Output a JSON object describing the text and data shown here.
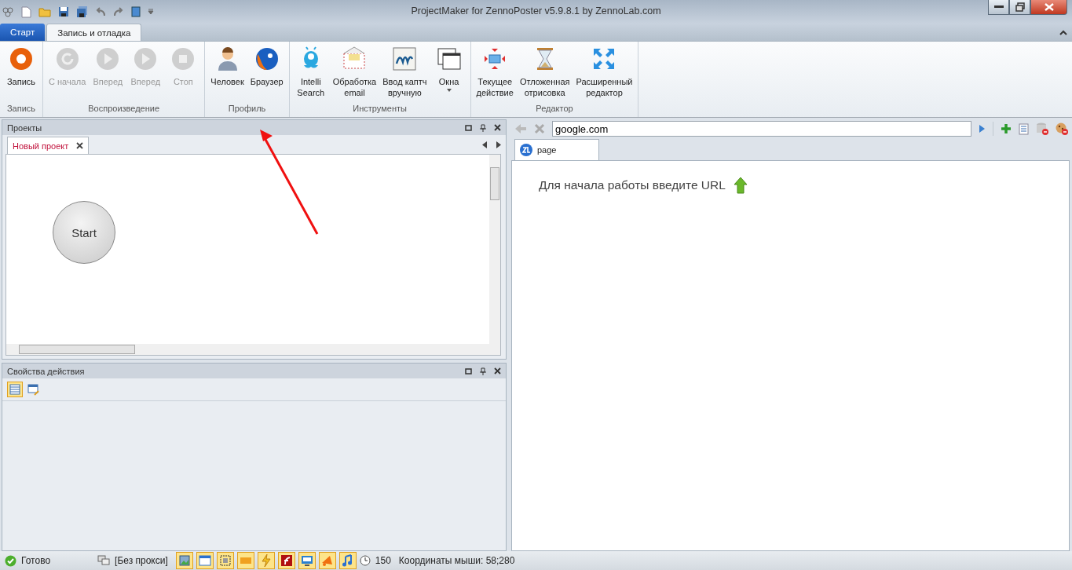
{
  "window": {
    "title": "ProjectMaker for ZennoPoster v5.9.8.1 by ZennoLab.com"
  },
  "ribbon": {
    "tabs": [
      {
        "label": "Старт",
        "selected": false
      },
      {
        "label": "Запись и отладка",
        "selected": true
      }
    ],
    "groups": [
      {
        "label": "Запись",
        "buttons": [
          {
            "label": "Запись",
            "disabled": false
          }
        ]
      },
      {
        "label": "Воспроизведение",
        "buttons": [
          {
            "label": "С начала",
            "disabled": true
          },
          {
            "label": "Вперед",
            "disabled": true
          },
          {
            "label": "Вперед",
            "disabled": true
          },
          {
            "label": "Стоп",
            "disabled": true
          }
        ]
      },
      {
        "label": "Профиль",
        "buttons": [
          {
            "label": "Человек",
            "disabled": false
          },
          {
            "label": "Браузер",
            "disabled": false
          }
        ]
      },
      {
        "label": "Инструменты",
        "buttons": [
          {
            "label": "Intelli\nSearch",
            "disabled": false
          },
          {
            "label": "Обработка\nemail",
            "disabled": false
          },
          {
            "label": "Ввод каптч\nвручную",
            "disabled": false
          },
          {
            "label": "Окна",
            "disabled": false
          }
        ]
      },
      {
        "label": "Редактор",
        "buttons": [
          {
            "label": "Текущее\nдействие",
            "disabled": false
          },
          {
            "label": "Отложенная\nотрисовка",
            "disabled": false
          },
          {
            "label": "Расширенный\nредактор",
            "disabled": false
          }
        ]
      }
    ]
  },
  "projects_panel": {
    "title": "Проекты",
    "tabs": [
      {
        "label": "Новый проект",
        "selected": true
      }
    ],
    "node": "Start"
  },
  "properties_panel": {
    "title": "Свойства действия"
  },
  "browser": {
    "url": "google.com",
    "tab": "page",
    "message": "Для начала работы введите URL"
  },
  "status_bar": {
    "status": "Готово",
    "proxy": "[Без прокси]",
    "count": "150",
    "coords": "Координаты мыши: 58;280"
  }
}
